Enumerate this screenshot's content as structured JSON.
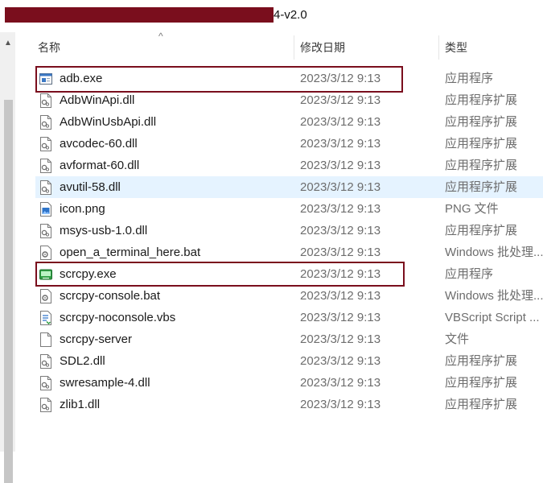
{
  "window": {
    "title_suffix": "4-v2.0"
  },
  "columns": {
    "name": "名称",
    "date": "修改日期",
    "type": "类型"
  },
  "files": [
    {
      "name": "adb.exe",
      "date": "2023/3/12 9:13",
      "type": "应用程序",
      "icon": "exe-window-icon"
    },
    {
      "name": "AdbWinApi.dll",
      "date": "2023/3/12 9:13",
      "type": "应用程序扩展",
      "icon": "dll-file-icon"
    },
    {
      "name": "AdbWinUsbApi.dll",
      "date": "2023/3/12 9:13",
      "type": "应用程序扩展",
      "icon": "dll-file-icon"
    },
    {
      "name": "avcodec-60.dll",
      "date": "2023/3/12 9:13",
      "type": "应用程序扩展",
      "icon": "dll-file-icon"
    },
    {
      "name": "avformat-60.dll",
      "date": "2023/3/12 9:13",
      "type": "应用程序扩展",
      "icon": "dll-file-icon"
    },
    {
      "name": "avutil-58.dll",
      "date": "2023/3/12 9:13",
      "type": "应用程序扩展",
      "icon": "dll-file-icon"
    },
    {
      "name": "icon.png",
      "date": "2023/3/12 9:13",
      "type": "PNG 文件",
      "icon": "png-image-icon"
    },
    {
      "name": "msys-usb-1.0.dll",
      "date": "2023/3/12 9:13",
      "type": "应用程序扩展",
      "icon": "dll-file-icon"
    },
    {
      "name": "open_a_terminal_here.bat",
      "date": "2023/3/12 9:13",
      "type": "Windows 批处理...",
      "icon": "bat-file-icon"
    },
    {
      "name": "scrcpy.exe",
      "date": "2023/3/12 9:13",
      "type": "应用程序",
      "icon": "scrcpy-app-icon"
    },
    {
      "name": "scrcpy-console.bat",
      "date": "2023/3/12 9:13",
      "type": "Windows 批处理...",
      "icon": "bat-file-icon"
    },
    {
      "name": "scrcpy-noconsole.vbs",
      "date": "2023/3/12 9:13",
      "type": "VBScript Script ...",
      "icon": "vbs-script-icon"
    },
    {
      "name": "scrcpy-server",
      "date": "2023/3/12 9:13",
      "type": "文件",
      "icon": "blank-file-icon"
    },
    {
      "name": "SDL2.dll",
      "date": "2023/3/12 9:13",
      "type": "应用程序扩展",
      "icon": "dll-file-icon"
    },
    {
      "name": "swresample-4.dll",
      "date": "2023/3/12 9:13",
      "type": "应用程序扩展",
      "icon": "dll-file-icon"
    },
    {
      "name": "zlib1.dll",
      "date": "2023/3/12 9:13",
      "type": "应用程序扩展",
      "icon": "dll-file-icon"
    }
  ],
  "hovered_index": 5,
  "highlighted_names": [
    "adb.exe",
    "scrcpy.exe"
  ],
  "colors": {
    "highlight_border": "#7a0e1d",
    "hover_row": "#e5f3ff",
    "secondary_text": "#6d6d6d"
  }
}
